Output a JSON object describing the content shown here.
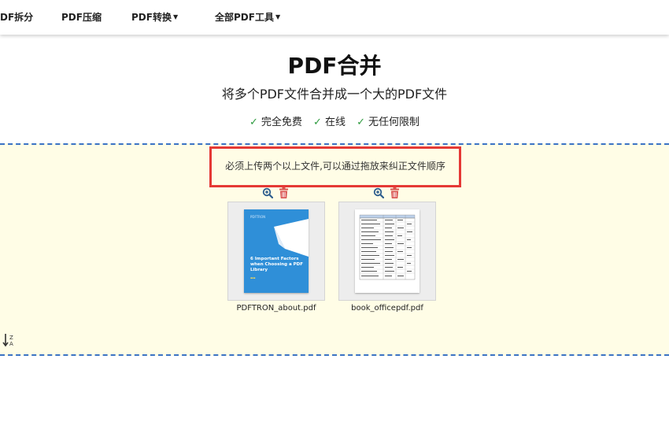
{
  "nav": {
    "items": [
      {
        "label": "DF拆分",
        "dropdown": false
      },
      {
        "label": "PDF压缩",
        "dropdown": false
      },
      {
        "label": "PDF转换",
        "dropdown": true
      },
      {
        "label": "全部PDF工具",
        "dropdown": true
      }
    ]
  },
  "page": {
    "title": "PDF合并",
    "subtitle": "将多个PDF文件合并成一个大的PDF文件",
    "features": [
      "完全免费",
      "在线",
      "无任何限制"
    ],
    "check_glyph": "✓"
  },
  "upload": {
    "notice": "必须上传两个以上文件,可以通过拖放来纠正文件顺序",
    "files": [
      {
        "name": "PDFTRON_about.pdf",
        "cover_brand": "PDFTRON",
        "cover_title": "6 Important Factors when Choosing a PDF Library"
      },
      {
        "name": "book_officepdf.pdf"
      }
    ],
    "sort_label": "Z A"
  },
  "colors": {
    "accent_border": "#3b73c4",
    "dropzone_bg": "#fffde6",
    "highlight": "#e53935",
    "check": "#2e9b3f",
    "delete": "#d9534f",
    "zoom": "#2f5f8f"
  }
}
